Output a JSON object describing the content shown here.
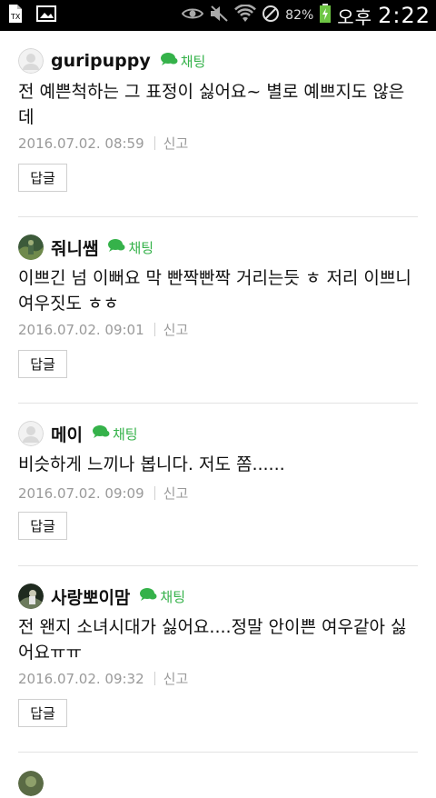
{
  "status_bar": {
    "battery_percent": "82%",
    "ampm": "오후",
    "time": "2:22"
  },
  "comments": [
    {
      "username": "guripuppy",
      "chat_label": "채팅",
      "text": "전 예쁜척하는 그 표정이 싫어요~ 별로 예쁘지도 않은데",
      "date": "2016.07.02. 08:59",
      "report_label": "신고",
      "reply_label": "답글"
    },
    {
      "username": "줘니쌤",
      "chat_label": "채팅",
      "text": "이쁘긴 넘 이뻐요 막 빤짝빤짝 거리는듯 ㅎ 저리 이쁘니 여우짓도 ㅎㅎ",
      "date": "2016.07.02. 09:01",
      "report_label": "신고",
      "reply_label": "답글"
    },
    {
      "username": "메이",
      "chat_label": "채팅",
      "text": "비슷하게 느끼나 봅니다. 저도 쫌......",
      "date": "2016.07.02. 09:09",
      "report_label": "신고",
      "reply_label": "답글"
    },
    {
      "username": "사랑뽀이맘",
      "chat_label": "채팅",
      "text": "전 왠지 소녀시대가 싫어요....정말 안이쁜 여우같아 싫어요ㅠㅠ",
      "date": "2016.07.02. 09:32",
      "report_label": "신고",
      "reply_label": "답글"
    }
  ],
  "colors": {
    "chat_green": "#35b24a",
    "meta_gray": "#9a9a9a",
    "divider": "#e3e3e3"
  }
}
